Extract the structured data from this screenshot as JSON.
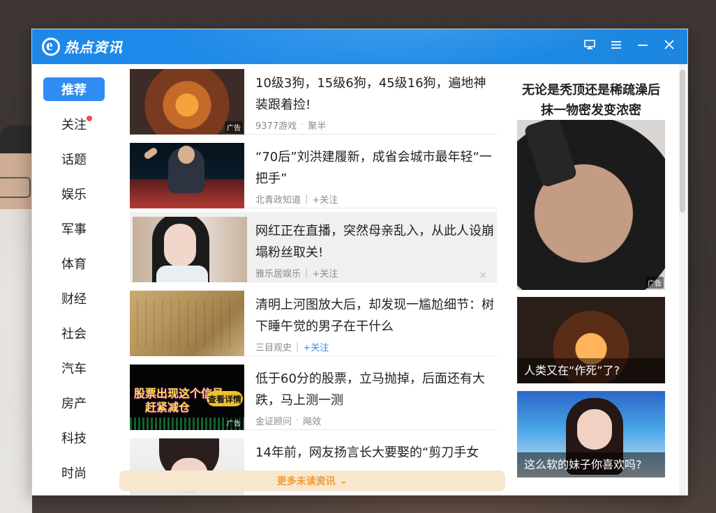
{
  "app": {
    "title": "热点资讯"
  },
  "titlebar": {
    "controls": [
      "desktop-icon",
      "menu-icon",
      "minimize-icon",
      "close-icon"
    ]
  },
  "sidebar": {
    "items": [
      {
        "label": "推荐",
        "active": true
      },
      {
        "label": "关注",
        "badge": true
      },
      {
        "label": "话题"
      },
      {
        "label": "娱乐"
      },
      {
        "label": "军事"
      },
      {
        "label": "体育"
      },
      {
        "label": "财经"
      },
      {
        "label": "社会"
      },
      {
        "label": "汽车"
      },
      {
        "label": "房产"
      },
      {
        "label": "科技"
      },
      {
        "label": "时尚"
      }
    ]
  },
  "feed": {
    "items": [
      {
        "title": "10级3狗，15级6狗，45级16狗，遍地神装跟着捡!",
        "source": "9377游戏",
        "extra": "聚半",
        "ad_tag": "广告"
      },
      {
        "title": "“70后”刘洪建履新，成省会城市最年轻“一把手”",
        "source": "北青政知道",
        "follow": "+关注"
      },
      {
        "title": "网红正在直播，突然母亲乱入，从此人设崩塌粉丝取关!",
        "source": "雅乐居娱乐",
        "follow": "+关注",
        "close": "×"
      },
      {
        "title": "清明上河图放大后，却发现一尴尬细节：树下睡午觉的男子在干什么",
        "source": "三目观史",
        "follow": "+关注"
      },
      {
        "title": "低于60分的股票，立马抛掉，后面还有大跌，马上测一测",
        "source": "金证顾问",
        "extra": "飚效",
        "ad_tag": "广告",
        "thumb_text1": "股票出现这个信号",
        "thumb_text2": "赶紧减仓",
        "thumb_btn": "查看详情"
      },
      {
        "title": "14年前，网友扬言长大要娶的“剪刀手女"
      }
    ]
  },
  "right": {
    "ad_title": "无论是秃顶还是稀疏澡后抹一物密发变浓密",
    "ad_tag": "广告",
    "cards": [
      {
        "caption": "人类又在“作死”了?"
      },
      {
        "caption": "这么软的妹子你喜欢吗?"
      }
    ]
  },
  "more_button": {
    "label": "更多未读资讯"
  }
}
